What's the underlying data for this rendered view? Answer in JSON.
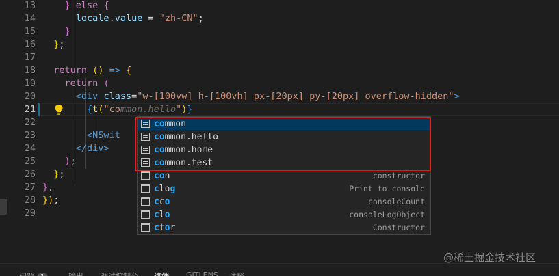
{
  "editor": {
    "lines": [
      {
        "num": "13",
        "html": "    <span class=\"br2\">}</span> <span class=\"kw\">else</span> <span class=\"br2\">{</span>"
      },
      {
        "num": "14",
        "html": "      <span class=\"var\">locale</span>.<span class=\"var\">value</span> = <span class=\"str\">\"zh-CN\"</span>;"
      },
      {
        "num": "15",
        "html": "    <span class=\"br2\">}</span>"
      },
      {
        "num": "16",
        "html": "  <span class=\"br1\">}</span>;"
      },
      {
        "num": "17",
        "html": ""
      },
      {
        "num": "18",
        "html": "  <span class=\"kw\">return</span> <span class=\"br1\">()</span> <span class=\"ctl\">=&gt;</span> <span class=\"br1\">{</span>"
      },
      {
        "num": "19",
        "html": "    <span class=\"kw\">return</span> <span class=\"br2\">(</span>"
      },
      {
        "num": "20",
        "html": "      <span class=\"tag\">&lt;div</span> <span class=\"attr\">class</span>=<span class=\"str\">\"w-[100vw] h-[100vh] px-[20px] py-[20px] overflow-hidden\"</span><span class=\"tag\">&gt;</span>"
      },
      {
        "num": "21",
        "html": "        <span class=\"br3\">{</span><span class=\"fn\">t</span><span class=\"br1\">(</span><span class=\"str\">\"co</span><span class=\"ghost\">mmon.hello</span><span class=\"str\">\"</span><span class=\"br1\">)</span><span class=\"br3\">}</span>"
      },
      {
        "num": "22",
        "html": ""
      },
      {
        "num": "23",
        "html": "        <span class=\"tag\">&lt;NSwit</span>"
      },
      {
        "num": "24",
        "html": "      <span class=\"tag\">&lt;/div&gt;</span>"
      },
      {
        "num": "25",
        "html": "    <span class=\"br2\">)</span>;"
      },
      {
        "num": "26",
        "html": "  <span class=\"br1\">}</span>;"
      },
      {
        "num": "27",
        "html": "<span class=\"br2\">}</span>,"
      },
      {
        "num": "28",
        "html": "<span class=\"br1\">})</span>;"
      },
      {
        "num": "29",
        "html": ""
      }
    ],
    "active_line": "21"
  },
  "suggestions": [
    {
      "match": "co",
      "rest": "mmon",
      "detail": "",
      "kind": "text-icon"
    },
    {
      "match": "co",
      "rest": "mmon.hello",
      "detail": "",
      "kind": "text-icon"
    },
    {
      "match": "co",
      "rest": "mmon.home",
      "detail": "",
      "kind": "text-icon"
    },
    {
      "match": "co",
      "rest": "mmon.test",
      "detail": "",
      "kind": "text-icon"
    },
    {
      "match": "co",
      "rest": "n",
      "detail": "constructor",
      "kind": "snippet-icon"
    },
    {
      "match": "c",
      "rest": "lo",
      "rest_bold": "g",
      "detail": "Print to console",
      "kind": "snippet-icon"
    },
    {
      "match": "c",
      "rest": "c",
      "rest_bold2": "o",
      "detail": "consoleCount",
      "kind": "snippet-icon"
    },
    {
      "match": "c",
      "rest": "l",
      "rest_bold2": "o",
      "detail": "consoleLogObject",
      "kind": "snippet-icon"
    },
    {
      "match": "c",
      "rest": "t",
      "rest_bold2": "o",
      "rest_tail": "r",
      "detail": "Constructor",
      "kind": "snippet-icon"
    }
  ],
  "panel": {
    "tabs": [
      {
        "label": "问题",
        "badge": "1"
      },
      {
        "label": "输出"
      },
      {
        "label": "调试控制台"
      },
      {
        "label": "终端",
        "active": true
      },
      {
        "label": "GITLENS"
      },
      {
        "label": "注释"
      }
    ]
  },
  "watermark": "@稀土掘金技术社区",
  "colors": {
    "highlight_border": "#e0201a",
    "selection": "#04395e",
    "match": "#2aaaff"
  }
}
